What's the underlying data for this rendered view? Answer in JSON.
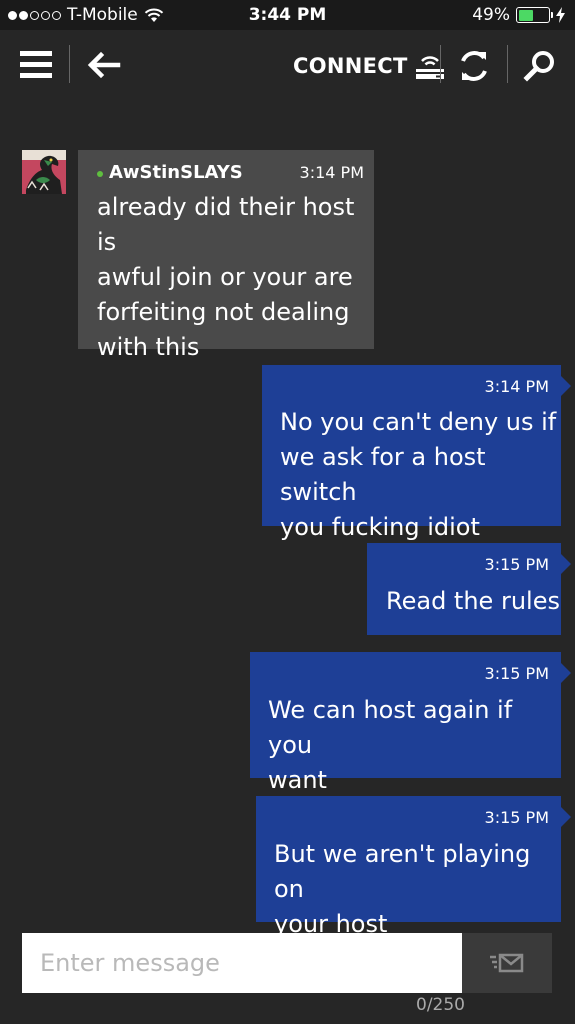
{
  "status_bar": {
    "carrier": "T-Mobile",
    "time": "3:44 PM",
    "battery_percent": "49%",
    "battery_level": 0.49,
    "icons": [
      "signal-dots-icon",
      "wifi-icon",
      "battery-icon",
      "charging-bolt-icon"
    ]
  },
  "toolbar": {
    "connect_label": "CONNECT",
    "icons": [
      "hamburger-menu-icon",
      "back-arrow-icon",
      "console-connect-icon",
      "refresh-icon",
      "search-icon"
    ]
  },
  "conversation": {
    "incoming": {
      "sender": "AwStinSLAYS",
      "time": "3:14 PM",
      "lines": [
        "already did their host is",
        "awful join or your are",
        "forfeiting not dealing",
        "with this"
      ]
    },
    "outgoing": [
      {
        "time": "3:14 PM",
        "lines": [
          "No you can't deny us if",
          "we ask for a host switch",
          "you fucking idiot"
        ]
      },
      {
        "time": "3:15 PM",
        "lines": [
          "Read the rules"
        ]
      },
      {
        "time": "3:15 PM",
        "lines": [
          "We can host again if you",
          "want"
        ]
      },
      {
        "time": "3:15 PM",
        "lines": [
          "But we aren't playing on",
          "your host"
        ]
      }
    ]
  },
  "composer": {
    "placeholder": "Enter message",
    "counter": "0/250"
  },
  "colors": {
    "background": "#262626",
    "incoming_bubble": "#4a4a4a",
    "outgoing_bubble": "#1e3f96",
    "online": "#5fbf3f",
    "battery": "#4cd964"
  }
}
